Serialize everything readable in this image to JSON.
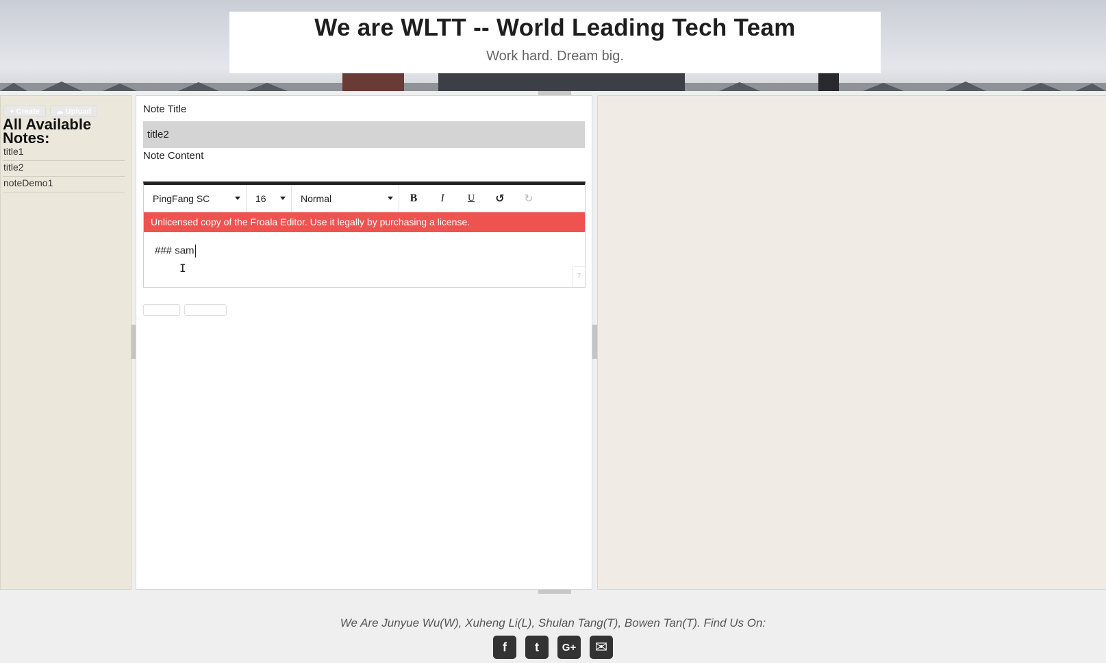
{
  "header": {
    "title": "We are WLTT -- World Leading Tech Team",
    "subtitle": "Work hard. Dream big."
  },
  "sidebar": {
    "create_label": "+ Create",
    "upload_label": "☁ Upload",
    "heading": "All Available Notes:",
    "notes": [
      "title1",
      "title2",
      "noteDemo1"
    ]
  },
  "editor": {
    "title_label": "Note Title",
    "title_value": "title2",
    "content_label": "Note Content",
    "toolbar": {
      "font_family": "PingFang SC",
      "font_size": "16",
      "paragraph_format": "Normal",
      "bold_icon": "B",
      "italic_icon": "I",
      "underline_icon": "U",
      "undo_icon": "↺",
      "redo_icon": "↻"
    },
    "license_notice": "Unlicensed copy of the Froala Editor. Use it legally by purchasing a license.",
    "content_text": "### sam",
    "resize_glyph": "7"
  },
  "footer": {
    "credits": "We Are Junyue Wu(W), Xuheng Li(L), Shulan Tang(T), Bowen Tan(T). Find Us On:",
    "social": [
      {
        "icon": "facebook-icon",
        "glyph": "f"
      },
      {
        "icon": "twitter-icon",
        "glyph": "t"
      },
      {
        "icon": "google-plus-icon",
        "glyph": "G+"
      },
      {
        "icon": "email-icon",
        "glyph": "✉"
      }
    ]
  }
}
